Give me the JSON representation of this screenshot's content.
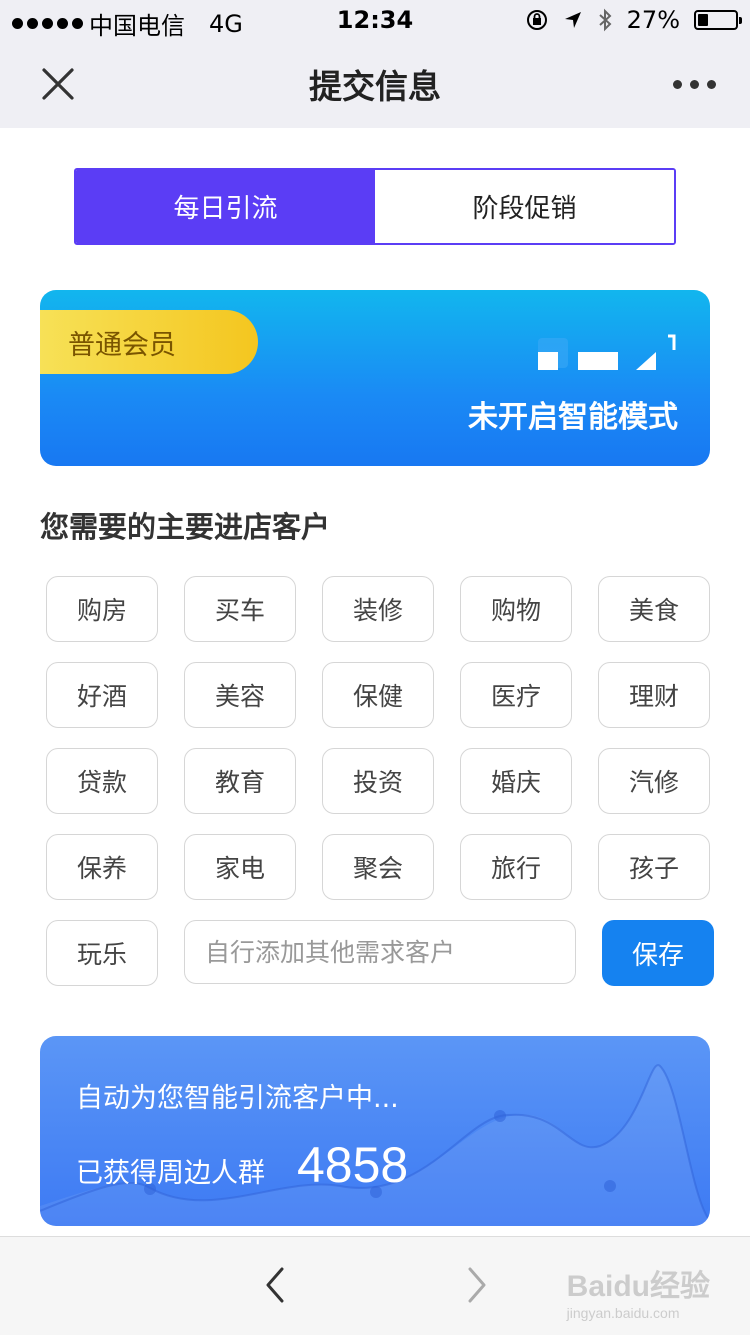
{
  "status_bar": {
    "carrier": "中国电信",
    "network": "4G",
    "time": "12:34",
    "battery": "27%"
  },
  "nav": {
    "title": "提交信息"
  },
  "tabs": [
    {
      "label": "每日引流",
      "active": true
    },
    {
      "label": "阶段促销",
      "active": false
    }
  ],
  "member_card": {
    "badge": "普通会员",
    "mode_text": "未开启智能模式"
  },
  "section_title": "您需要的主要进店客户",
  "chips": [
    "购房",
    "买车",
    "装修",
    "购物",
    "美食",
    "好酒",
    "美容",
    "保健",
    "医疗",
    "理财",
    "贷款",
    "教育",
    "投资",
    "婚庆",
    "汽修",
    "保养",
    "家电",
    "聚会",
    "旅行",
    "孩子",
    "玩乐"
  ],
  "custom_input": {
    "placeholder": "自行添加其他需求客户"
  },
  "save_label": "保存",
  "stats": {
    "line1": "自动为您智能引流客户中...",
    "label": "已获得周边人群",
    "count": "4858"
  },
  "watermark": {
    "text": "Baidu经验",
    "sub": "jingyan.baidu.com"
  },
  "colors": {
    "accent": "#5b3df5",
    "primary_button": "#1582f0",
    "badge": "#f4c61f"
  }
}
